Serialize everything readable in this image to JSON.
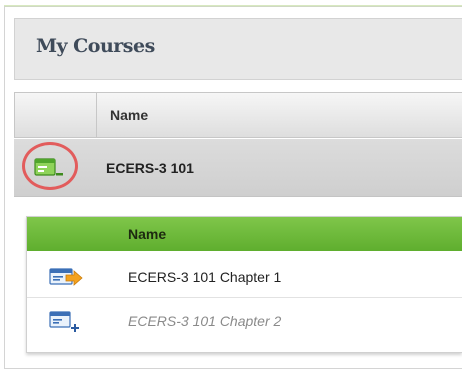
{
  "panel": {
    "title": "My Courses"
  },
  "courses_table": {
    "columns": [
      "",
      "Name"
    ],
    "rows": [
      {
        "icon": "course-expanded-icon",
        "name": "ECERS-3 101",
        "highlighted": true,
        "chapters": {
          "columns": [
            "",
            "Name"
          ],
          "rows": [
            {
              "icon": "chapter-launch-icon",
              "name": "ECERS-3 101 Chapter 1",
              "state": "available"
            },
            {
              "icon": "chapter-locked-add-icon",
              "name": "ECERS-3 101 Chapter 2",
              "state": "unavailable"
            }
          ]
        }
      }
    ]
  },
  "colors": {
    "accent_green": "#6cba3a",
    "highlight_circle": "#e25c5c",
    "icon_blue": "#3b6fb6",
    "arrow_orange": "#f3a21f",
    "disabled_text": "#8a8a8a"
  }
}
